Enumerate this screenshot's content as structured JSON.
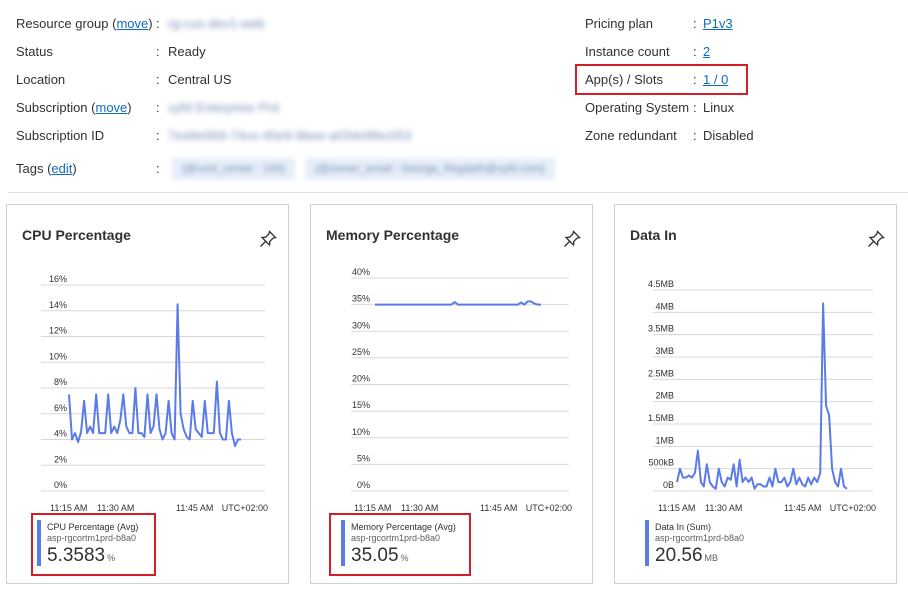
{
  "essentials": {
    "left": [
      {
        "label": "Resource group (",
        "link": "move",
        "label_suffix": ")",
        "value": "rg-cus-dev1-web",
        "value_blurred": true,
        "value_link": true
      },
      {
        "label": "Status",
        "value": "Ready"
      },
      {
        "label": "Location",
        "value": "Central US"
      },
      {
        "label": "Subscription (",
        "link": "move",
        "label_suffix": ")",
        "value": "xyfd Enterprise Prd",
        "value_blurred": true,
        "value_link": true
      },
      {
        "label": "Subscription ID",
        "value": "7ed4e069-74ce-45e9-9bee-a034e9fec053",
        "value_blurred": true
      }
    ],
    "right": [
      {
        "label": "Pricing plan",
        "value": "P1v3",
        "value_link": true
      },
      {
        "label": "Instance count",
        "value": "2",
        "value_link": true
      },
      {
        "label": "App(s) / Slots",
        "value": "1 / 0",
        "value_link": true
      },
      {
        "label": "Operating System",
        "value": "Linux"
      },
      {
        "label": "Zone redundant",
        "value": "Disabled"
      }
    ],
    "tags": {
      "label": "Tags (",
      "link": "edit",
      "label_suffix": ")",
      "items": [
        "{@cost_center : 195}",
        "{@owner_email : George_Regdeth@xyfd.com}"
      ]
    },
    "colon": ":"
  },
  "cards": [
    {
      "title": "CPU Percentage",
      "legend_name": "CPU Percentage (Avg)",
      "legend_resource": "asp-rgcortm1prd-b8a0",
      "legend_value": "5.3583",
      "legend_unit": "%",
      "timezone": "UTC+02:00",
      "x_ticks": [
        "11:15 AM",
        "11:30 AM",
        "11:45 AM"
      ],
      "chart_data": {
        "type": "line",
        "y_ticks": [
          "16%",
          "14%",
          "12%",
          "10%",
          "8%",
          "6%",
          "4%",
          "2%",
          "0%"
        ],
        "ylim": [
          0,
          16
        ],
        "series": [
          {
            "values": [
              7.5,
              4,
              4.5,
              3.8,
              4.6,
              7,
              4.5,
              5,
              4.5,
              7.5,
              4.5,
              4.5,
              4.5,
              7.5,
              4.5,
              5,
              4.5,
              5.5,
              7.5,
              5,
              4.5,
              4.5,
              8,
              4.5,
              4.5,
              4.2,
              7.5,
              4.5,
              5,
              7.5,
              4.8,
              4,
              4.5,
              7,
              4.5,
              4,
              14.5,
              6,
              4.8,
              4.2,
              4,
              7,
              4.8,
              4.5,
              4.2,
              7,
              4.5,
              4.5,
              4.5,
              8.5,
              4.5,
              4,
              4,
              7,
              4.5,
              3.5,
              4,
              4
            ]
          }
        ]
      }
    },
    {
      "title": "Memory Percentage",
      "legend_name": "Memory Percentage (Avg)",
      "legend_resource": "asp-rgcortm1prd-b8a0",
      "legend_value": "35.05",
      "legend_unit": "%",
      "timezone": "UTC+02:00",
      "x_ticks": [
        "11:15 AM",
        "11:30 AM",
        "11:45 AM"
      ],
      "chart_data": {
        "type": "line",
        "y_ticks": [
          "40%",
          "35%",
          "30%",
          "25%",
          "20%",
          "15%",
          "10%",
          "5%",
          "0%"
        ],
        "ylim": [
          0,
          40
        ],
        "series": [
          {
            "values": [
              35,
              35,
              35,
              35,
              35,
              35,
              35,
              35,
              35,
              35,
              35,
              35,
              35,
              35,
              35,
              35,
              35,
              35,
              35,
              35,
              35,
              35,
              35,
              35,
              35.5,
              35,
              35,
              35,
              35,
              35,
              35,
              35,
              35,
              35,
              35,
              35,
              35,
              35,
              35,
              35,
              35,
              35,
              35,
              35,
              35.4,
              35,
              35.6,
              35.6,
              35.2,
              35,
              35
            ]
          }
        ]
      }
    },
    {
      "title": "Data In",
      "legend_name": "Data In (Sum)",
      "legend_resource": "asp-rgcortm1prd-b8a0",
      "legend_value": "20.56",
      "legend_unit": "MB",
      "timezone": "UTC+02:00",
      "x_ticks": [
        "11:15 AM",
        "11:30 AM",
        "11:45 AM"
      ],
      "chart_data": {
        "type": "line",
        "y_ticks": [
          "4.5MB",
          "4MB",
          "3.5MB",
          "3MB",
          "2.5MB",
          "2MB",
          "1.5MB",
          "1MB",
          "500kB",
          "0B"
        ],
        "ylim": [
          0,
          4.5
        ],
        "series": [
          {
            "values": [
              0.2,
              0.5,
              0.3,
              0.3,
              0.35,
              0.3,
              0.4,
              0.9,
              0.2,
              0.1,
              0.6,
              0.2,
              0.1,
              0.05,
              0.5,
              0.2,
              0.1,
              0.3,
              0.25,
              0.6,
              0.1,
              0.7,
              0.2,
              0.3,
              0.2,
              0.3,
              0.05,
              0.15,
              0.15,
              0.1,
              0.1,
              0.3,
              0.1,
              0.5,
              0.2,
              0.2,
              0.3,
              0.1,
              0.2,
              0.5,
              0.15,
              0.3,
              0.15,
              0.1,
              0.3,
              0.15,
              0.3,
              0.2,
              0.4,
              4.2,
              1.9,
              1.7,
              0.5,
              0.2,
              0.1,
              0.5,
              0.1,
              0.05
            ]
          }
        ]
      }
    }
  ],
  "colors": {
    "accent": "#0f6cbd",
    "series": "#5b7be8",
    "highlight": "#d21f2a",
    "grid": "#d8d8d8"
  },
  "icons": {
    "pin": "pin-icon"
  }
}
